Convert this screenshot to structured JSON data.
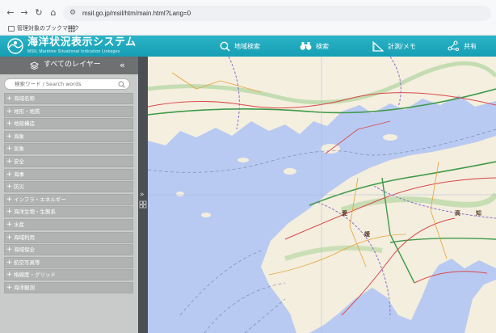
{
  "browser": {
    "url": "msil.go.jp/msil/htm/main.html?Lang=0",
    "bookmark_label": "管理対象のブックマーク"
  },
  "header": {
    "title": "海洋状況表示システム",
    "subtitle": "MSIL Maritime Situational Indication Linkages",
    "nav": [
      {
        "label": "地域検索",
        "icon": "search-icon"
      },
      {
        "label": "検索",
        "icon": "binoculars-icon"
      },
      {
        "label": "計測/メモ",
        "icon": "ruler-icon"
      },
      {
        "label": "共有",
        "icon": "share-icon"
      }
    ],
    "brand_color": "#1ea8bc"
  },
  "sidebar": {
    "title": "すべてのレイヤー",
    "collapse_glyph": "«",
    "search_placeholder": "検索ワード / Search words",
    "layers": [
      "海域名称",
      "地形・地質",
      "地殻構造",
      "海象",
      "気象",
      "安全",
      "海事",
      "防災",
      "インフラ・エネルギー",
      "海洋生物・生態系",
      "水産",
      "海域利用",
      "海域保全",
      "航空写真等",
      "格線度・グリッド",
      "海洋観測"
    ]
  },
  "map": {
    "place_labels": [
      "愛",
      "媛",
      "高",
      "知"
    ]
  }
}
